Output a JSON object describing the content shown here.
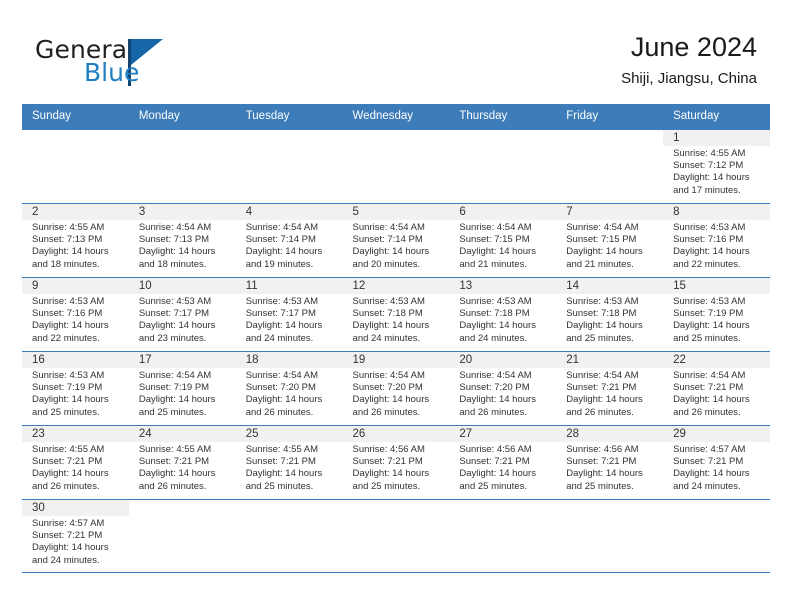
{
  "brand": {
    "name_part1": "General",
    "name_part2": "Blue",
    "accent_color": "#1f7ec2",
    "header_color": "#3c7cb8"
  },
  "header": {
    "title": "June 2024",
    "subtitle": "Shiji, Jiangsu, China"
  },
  "weekdays": [
    "Sunday",
    "Monday",
    "Tuesday",
    "Wednesday",
    "Thursday",
    "Friday",
    "Saturday"
  ],
  "weeks": [
    [
      {
        "day": "",
        "sunrise": "",
        "sunset": "",
        "daylight1": "",
        "daylight2": ""
      },
      {
        "day": "",
        "sunrise": "",
        "sunset": "",
        "daylight1": "",
        "daylight2": ""
      },
      {
        "day": "",
        "sunrise": "",
        "sunset": "",
        "daylight1": "",
        "daylight2": ""
      },
      {
        "day": "",
        "sunrise": "",
        "sunset": "",
        "daylight1": "",
        "daylight2": ""
      },
      {
        "day": "",
        "sunrise": "",
        "sunset": "",
        "daylight1": "",
        "daylight2": ""
      },
      {
        "day": "",
        "sunrise": "",
        "sunset": "",
        "daylight1": "",
        "daylight2": ""
      },
      {
        "day": "1",
        "sunrise": "Sunrise: 4:55 AM",
        "sunset": "Sunset: 7:12 PM",
        "daylight1": "Daylight: 14 hours",
        "daylight2": "and 17 minutes."
      }
    ],
    [
      {
        "day": "2",
        "sunrise": "Sunrise: 4:55 AM",
        "sunset": "Sunset: 7:13 PM",
        "daylight1": "Daylight: 14 hours",
        "daylight2": "and 18 minutes."
      },
      {
        "day": "3",
        "sunrise": "Sunrise: 4:54 AM",
        "sunset": "Sunset: 7:13 PM",
        "daylight1": "Daylight: 14 hours",
        "daylight2": "and 18 minutes."
      },
      {
        "day": "4",
        "sunrise": "Sunrise: 4:54 AM",
        "sunset": "Sunset: 7:14 PM",
        "daylight1": "Daylight: 14 hours",
        "daylight2": "and 19 minutes."
      },
      {
        "day": "5",
        "sunrise": "Sunrise: 4:54 AM",
        "sunset": "Sunset: 7:14 PM",
        "daylight1": "Daylight: 14 hours",
        "daylight2": "and 20 minutes."
      },
      {
        "day": "6",
        "sunrise": "Sunrise: 4:54 AM",
        "sunset": "Sunset: 7:15 PM",
        "daylight1": "Daylight: 14 hours",
        "daylight2": "and 21 minutes."
      },
      {
        "day": "7",
        "sunrise": "Sunrise: 4:54 AM",
        "sunset": "Sunset: 7:15 PM",
        "daylight1": "Daylight: 14 hours",
        "daylight2": "and 21 minutes."
      },
      {
        "day": "8",
        "sunrise": "Sunrise: 4:53 AM",
        "sunset": "Sunset: 7:16 PM",
        "daylight1": "Daylight: 14 hours",
        "daylight2": "and 22 minutes."
      }
    ],
    [
      {
        "day": "9",
        "sunrise": "Sunrise: 4:53 AM",
        "sunset": "Sunset: 7:16 PM",
        "daylight1": "Daylight: 14 hours",
        "daylight2": "and 22 minutes."
      },
      {
        "day": "10",
        "sunrise": "Sunrise: 4:53 AM",
        "sunset": "Sunset: 7:17 PM",
        "daylight1": "Daylight: 14 hours",
        "daylight2": "and 23 minutes."
      },
      {
        "day": "11",
        "sunrise": "Sunrise: 4:53 AM",
        "sunset": "Sunset: 7:17 PM",
        "daylight1": "Daylight: 14 hours",
        "daylight2": "and 24 minutes."
      },
      {
        "day": "12",
        "sunrise": "Sunrise: 4:53 AM",
        "sunset": "Sunset: 7:18 PM",
        "daylight1": "Daylight: 14 hours",
        "daylight2": "and 24 minutes."
      },
      {
        "day": "13",
        "sunrise": "Sunrise: 4:53 AM",
        "sunset": "Sunset: 7:18 PM",
        "daylight1": "Daylight: 14 hours",
        "daylight2": "and 24 minutes."
      },
      {
        "day": "14",
        "sunrise": "Sunrise: 4:53 AM",
        "sunset": "Sunset: 7:18 PM",
        "daylight1": "Daylight: 14 hours",
        "daylight2": "and 25 minutes."
      },
      {
        "day": "15",
        "sunrise": "Sunrise: 4:53 AM",
        "sunset": "Sunset: 7:19 PM",
        "daylight1": "Daylight: 14 hours",
        "daylight2": "and 25 minutes."
      }
    ],
    [
      {
        "day": "16",
        "sunrise": "Sunrise: 4:53 AM",
        "sunset": "Sunset: 7:19 PM",
        "daylight1": "Daylight: 14 hours",
        "daylight2": "and 25 minutes."
      },
      {
        "day": "17",
        "sunrise": "Sunrise: 4:54 AM",
        "sunset": "Sunset: 7:19 PM",
        "daylight1": "Daylight: 14 hours",
        "daylight2": "and 25 minutes."
      },
      {
        "day": "18",
        "sunrise": "Sunrise: 4:54 AM",
        "sunset": "Sunset: 7:20 PM",
        "daylight1": "Daylight: 14 hours",
        "daylight2": "and 26 minutes."
      },
      {
        "day": "19",
        "sunrise": "Sunrise: 4:54 AM",
        "sunset": "Sunset: 7:20 PM",
        "daylight1": "Daylight: 14 hours",
        "daylight2": "and 26 minutes."
      },
      {
        "day": "20",
        "sunrise": "Sunrise: 4:54 AM",
        "sunset": "Sunset: 7:20 PM",
        "daylight1": "Daylight: 14 hours",
        "daylight2": "and 26 minutes."
      },
      {
        "day": "21",
        "sunrise": "Sunrise: 4:54 AM",
        "sunset": "Sunset: 7:21 PM",
        "daylight1": "Daylight: 14 hours",
        "daylight2": "and 26 minutes."
      },
      {
        "day": "22",
        "sunrise": "Sunrise: 4:54 AM",
        "sunset": "Sunset: 7:21 PM",
        "daylight1": "Daylight: 14 hours",
        "daylight2": "and 26 minutes."
      }
    ],
    [
      {
        "day": "23",
        "sunrise": "Sunrise: 4:55 AM",
        "sunset": "Sunset: 7:21 PM",
        "daylight1": "Daylight: 14 hours",
        "daylight2": "and 26 minutes."
      },
      {
        "day": "24",
        "sunrise": "Sunrise: 4:55 AM",
        "sunset": "Sunset: 7:21 PM",
        "daylight1": "Daylight: 14 hours",
        "daylight2": "and 26 minutes."
      },
      {
        "day": "25",
        "sunrise": "Sunrise: 4:55 AM",
        "sunset": "Sunset: 7:21 PM",
        "daylight1": "Daylight: 14 hours",
        "daylight2": "and 25 minutes."
      },
      {
        "day": "26",
        "sunrise": "Sunrise: 4:56 AM",
        "sunset": "Sunset: 7:21 PM",
        "daylight1": "Daylight: 14 hours",
        "daylight2": "and 25 minutes."
      },
      {
        "day": "27",
        "sunrise": "Sunrise: 4:56 AM",
        "sunset": "Sunset: 7:21 PM",
        "daylight1": "Daylight: 14 hours",
        "daylight2": "and 25 minutes."
      },
      {
        "day": "28",
        "sunrise": "Sunrise: 4:56 AM",
        "sunset": "Sunset: 7:21 PM",
        "daylight1": "Daylight: 14 hours",
        "daylight2": "and 25 minutes."
      },
      {
        "day": "29",
        "sunrise": "Sunrise: 4:57 AM",
        "sunset": "Sunset: 7:21 PM",
        "daylight1": "Daylight: 14 hours",
        "daylight2": "and 24 minutes."
      }
    ],
    [
      {
        "day": "30",
        "sunrise": "Sunrise: 4:57 AM",
        "sunset": "Sunset: 7:21 PM",
        "daylight1": "Daylight: 14 hours",
        "daylight2": "and 24 minutes."
      },
      {
        "day": "",
        "sunrise": "",
        "sunset": "",
        "daylight1": "",
        "daylight2": ""
      },
      {
        "day": "",
        "sunrise": "",
        "sunset": "",
        "daylight1": "",
        "daylight2": ""
      },
      {
        "day": "",
        "sunrise": "",
        "sunset": "",
        "daylight1": "",
        "daylight2": ""
      },
      {
        "day": "",
        "sunrise": "",
        "sunset": "",
        "daylight1": "",
        "daylight2": ""
      },
      {
        "day": "",
        "sunrise": "",
        "sunset": "",
        "daylight1": "",
        "daylight2": ""
      },
      {
        "day": "",
        "sunrise": "",
        "sunset": "",
        "daylight1": "",
        "daylight2": ""
      }
    ]
  ]
}
